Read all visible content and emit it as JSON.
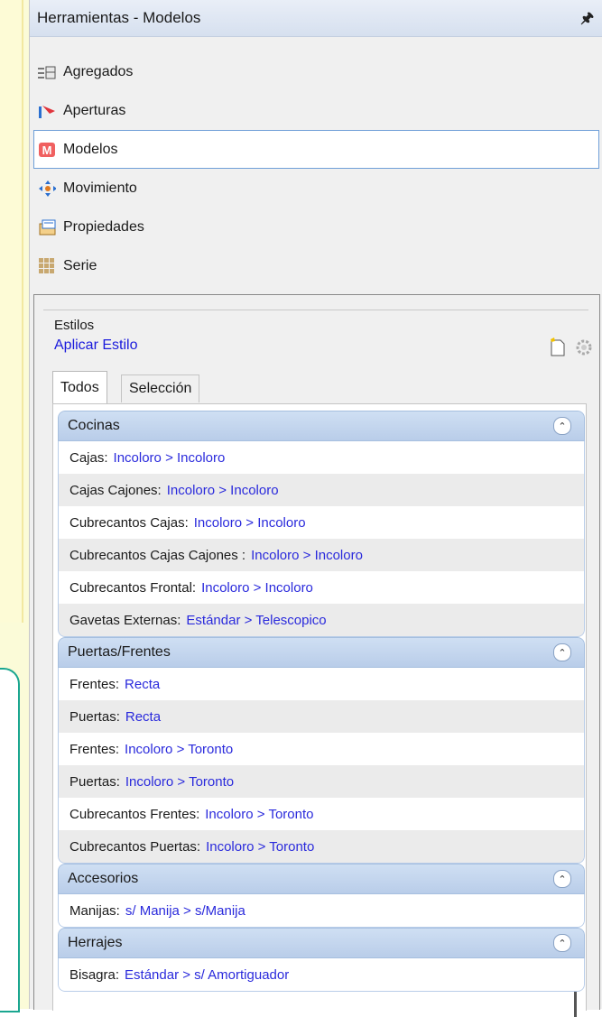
{
  "window": {
    "title": "Herramientas - Modelos",
    "pin_icon": "pin-icon"
  },
  "nav": {
    "items": [
      {
        "label": "Agregados",
        "icon": "aggregates-icon"
      },
      {
        "label": "Aperturas",
        "icon": "openings-icon"
      },
      {
        "label": "Modelos",
        "icon": "models-icon",
        "selected": true
      },
      {
        "label": "Movimiento",
        "icon": "move-icon"
      },
      {
        "label": "Propiedades",
        "icon": "properties-icon"
      },
      {
        "label": "Serie",
        "icon": "series-icon"
      }
    ]
  },
  "styles": {
    "group_label": "Estilos",
    "apply_link": "Aplicar Estilo"
  },
  "tabs": [
    {
      "label": "Todos",
      "active": true
    },
    {
      "label": "Selección",
      "active": false
    }
  ],
  "groups": [
    {
      "title": "Cocinas",
      "rows": [
        {
          "label": "Cajas:",
          "value": "Incoloro > Incoloro"
        },
        {
          "label": "Cajas Cajones:",
          "value": "Incoloro > Incoloro"
        },
        {
          "label": "Cubrecantos Cajas:",
          "value": "Incoloro > Incoloro"
        },
        {
          "label": "Cubrecantos Cajas Cajones :",
          "value": "Incoloro > Incoloro"
        },
        {
          "label": "Cubrecantos Frontal:",
          "value": "Incoloro > Incoloro"
        },
        {
          "label": "Gavetas Externas:",
          "value": "Estándar > Telescopico"
        }
      ]
    },
    {
      "title": "Puertas/Frentes",
      "rows": [
        {
          "label": "Frentes:",
          "value": "Recta"
        },
        {
          "label": "Puertas:",
          "value": "Recta"
        },
        {
          "label": "Frentes:",
          "value": "Incoloro > Toronto"
        },
        {
          "label": "Puertas:",
          "value": "Incoloro > Toronto"
        },
        {
          "label": "Cubrecantos Frentes:",
          "value": "Incoloro > Toronto"
        },
        {
          "label": "Cubrecantos Puertas:",
          "value": "Incoloro > Toronto"
        }
      ]
    },
    {
      "title": "Accesorios",
      "rows": [
        {
          "label": "Manijas:",
          "value": "s/ Manija > s/Manija"
        }
      ]
    },
    {
      "title": "Herrajes",
      "rows": [
        {
          "label": "Bisagra:",
          "value": "Estándar > s/ Amortiguador"
        }
      ]
    }
  ],
  "colors": {
    "link": "#1a1adc",
    "group_header": "#b9cde9",
    "selected_border": "#6f9fd8"
  }
}
